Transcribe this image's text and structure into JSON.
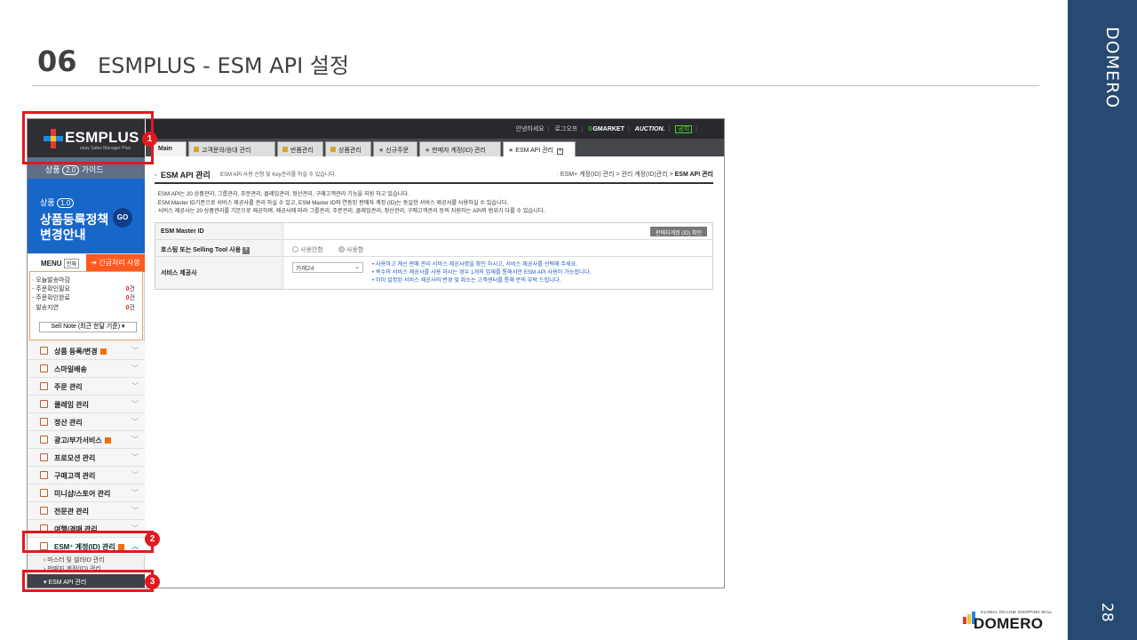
{
  "slide": {
    "number": "06",
    "title": "ESMPLUS - ESM API 설정",
    "brand": "DOMERO",
    "page_number": "28",
    "footer_logo_text": "DOMERO",
    "footer_logo_tagline": "GLOBAL ON-LINE SHOPPING MALL"
  },
  "sidebar": {
    "logo": "ESMPLUS",
    "logo_sub": "ebay Sales Manager Plus",
    "v20_prefix": "상품",
    "v20_badge": "2.0",
    "v20_suffix": "가이드",
    "banner_prefix": "상품",
    "banner_badge": "1.0",
    "banner_line1": "상품등록정책",
    "banner_line2": "변경안내",
    "banner_go": "GO",
    "menu_label": "MENU",
    "menu_all": "전체",
    "urgent_label": "긴급처리 사항",
    "status": [
      {
        "label": "· 오늘발송마감",
        "count": "",
        "unit": ""
      },
      {
        "label": "  - 주문확인필요",
        "count": "0",
        "unit": "건"
      },
      {
        "label": "  - 주문확인완료",
        "count": "0",
        "unit": "건"
      },
      {
        "label": "· 발송지연",
        "count": "0",
        "unit": "건"
      }
    ],
    "sell_note": "Sell Note (최근 한달 기준) ▾",
    "items": [
      {
        "label": "상품 등록/변경",
        "new": true
      },
      {
        "label": "스마일배송",
        "new": false
      },
      {
        "label": "주문 관리",
        "new": false
      },
      {
        "label": "클레임 관리",
        "new": false
      },
      {
        "label": "정산 관리",
        "new": false
      },
      {
        "label": "광고/부가서비스",
        "new": true
      },
      {
        "label": "프로모션 관리",
        "new": false
      },
      {
        "label": "구매고객 관리",
        "new": false
      },
      {
        "label": "미니샵/스토어 관리",
        "new": false
      },
      {
        "label": "전문관 관리",
        "new": false
      },
      {
        "label": "여행/경매 관리",
        "new": false
      },
      {
        "label": "ESM⁺ 계정(ID) 관리",
        "new": true
      }
    ],
    "sub_items": [
      "마스터 및 셀러ID 관리",
      "판매자 계정(ID) 관리"
    ],
    "selected_item": "▾  ESM API 관리"
  },
  "topbar": {
    "links": [
      "안녕하세요",
      "로그오프"
    ],
    "gmarket": "GMARKET",
    "auction": "AUCTION.",
    "notice": "공지"
  },
  "tabs": [
    {
      "label": "Main",
      "type": "main"
    },
    {
      "label": "고객문의/응대 관리",
      "type": "folder"
    },
    {
      "label": "반품관리",
      "type": "folder"
    },
    {
      "label": "상품관리",
      "type": "folder"
    },
    {
      "label": "신규주문",
      "type": "star"
    },
    {
      "label": "판매자 계정(ID) 관리",
      "type": "star"
    },
    {
      "label": "ESM API 관리",
      "type": "current"
    }
  ],
  "content": {
    "title": "ESM API 관리",
    "description": "ESM API 사용 신청 및 Key관리를 하실 수 있습니다.",
    "breadcrumb_prefix": "· ESM+ 계정(ID) 관리 > 관리 계정(ID)관리 > ",
    "breadcrumb_current": "ESM API 관리",
    "notes": [
      "· ESM API는 20 상품관리, 그룹관리, 주문관리, 클레임관리, 정산관리, 구매고객관리 기능을 지원 하고 있습니다.",
      "· ESM Master ID기준으로 서비스 제공사를 관리 하실 수 있고, ESM Master ID와 연동된 판매자 계정 (ID)는 동일한 서비스 제공사를 사용하실 수 있습니다.",
      "· 서비스 제공사는 20 상품관리를 기본으로 제공하며, 제공사에 따라 그룹관리, 주문관리, 클레임관리, 정산관리, 구매고객관리 등의 지원하는 API의 범위가 다를 수 있습니다."
    ],
    "master_id_label": "ESM Master ID",
    "master_id_button": "판매자계정 (ID) 확인",
    "hosting_label": "호스팅 또는 Selling Tool 사용",
    "hosting_help": "?",
    "radio_off": "사용안함",
    "radio_on": "사용함",
    "provider_label": "서비스 제공사",
    "provider_value": "카페24",
    "provider_notes": [
      "• 사용하고 계신 판매 관리 서비스 제공사명을 확인 하시고, 서비스 제공사를 선택해 주세요.",
      "• 복수의 서비스 제공사를 사용 하시는 경우 1개의 업체를 통해서만 ESM API 사용이 가능합니다.",
      "• 이미 설정된 서비스 제공사의 변경 및 취소는 고객센터를 통해 문의 부탁 드립니다."
    ]
  },
  "callouts": [
    "1",
    "2",
    "3"
  ],
  "colors": {
    "band": "#264a72",
    "highlight": "#e1191f",
    "banner": "#1767c9",
    "urgent": "#ff5a1f"
  }
}
